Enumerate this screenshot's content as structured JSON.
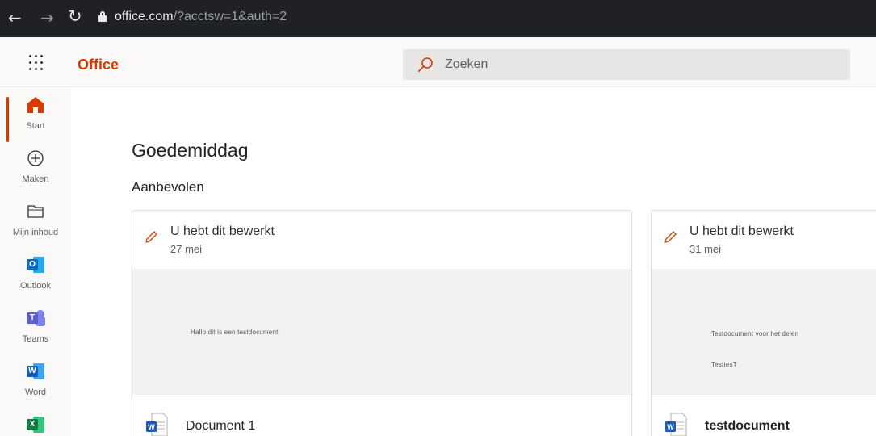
{
  "browser": {
    "url_domain": "office.com",
    "url_path": "/?acctsw=1&auth=2"
  },
  "header": {
    "brand": "Office",
    "search_placeholder": "Zoeken"
  },
  "rail": {
    "items": [
      {
        "label": "Start",
        "icon": "home-icon"
      },
      {
        "label": "Maken",
        "icon": "plus-circle-icon"
      },
      {
        "label": "Mijn inhoud",
        "icon": "folder-icon"
      },
      {
        "label": "Outlook",
        "icon": "outlook-icon"
      },
      {
        "label": "Teams",
        "icon": "teams-icon"
      },
      {
        "label": "Word",
        "icon": "word-icon"
      },
      {
        "label": "",
        "icon": "excel-icon"
      }
    ]
  },
  "main": {
    "greeting": "Goedemiddag",
    "section_title": "Aanbevolen",
    "cards": [
      {
        "action": "U hebt dit bewerkt",
        "date": "27 mei",
        "preview_lines": [
          "Hallo dit is een testdocument"
        ],
        "filename": "Document 1"
      },
      {
        "action": "U hebt dit bewerkt",
        "date": "31 mei",
        "preview_lines": [
          "Testdocument voor het delen",
          "TesttesT"
        ],
        "filename": "testdocument"
      }
    ]
  },
  "colors": {
    "accent": "#d83b01",
    "word": "#185abd",
    "outlook": "#0f6cbd",
    "teams": "#5b5fc7",
    "excel": "#107c41"
  }
}
